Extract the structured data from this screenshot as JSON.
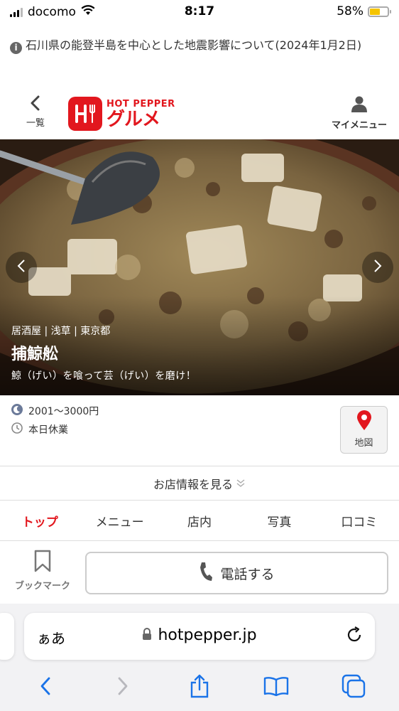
{
  "status_bar": {
    "carrier": "docomo",
    "time": "8:17",
    "battery_text": "58%",
    "battery_level": 0.58
  },
  "notice": {
    "text": "石川県の能登半島を中心とした地震影響について(2024年1月2日)"
  },
  "header": {
    "back_label": "一覧",
    "logo_top": "HOT PEPPER",
    "logo_bottom": "グルメ",
    "mymenu_label": "マイメニュー"
  },
  "hero": {
    "category": "居酒屋 | 浅草 | 東京都",
    "shop_name": "捕鯨舩",
    "catch_copy": "鯨（げい）を喰って芸（げい）を磨け！"
  },
  "info": {
    "budget": "2001〜3000円",
    "holiday": "本日休業",
    "map_label": "地図"
  },
  "shop_info_link": "お店情報を見る",
  "tabs": [
    {
      "label": "トップ",
      "active": true
    },
    {
      "label": "メニュー",
      "active": false
    },
    {
      "label": "店内",
      "active": false
    },
    {
      "label": "写真",
      "active": false
    },
    {
      "label": "口コミ",
      "active": false
    }
  ],
  "actions": {
    "bookmark_label": "ブックマーク",
    "call_label": "電話する"
  },
  "safari": {
    "aa_label": "ぁあ",
    "url": "hotpepper.jp"
  },
  "colors": {
    "brand_red": "#e2171e",
    "battery_yellow": "#f5c400"
  },
  "icons": [
    "wifi-icon",
    "battery-icon",
    "info-icon",
    "chevron-left-icon",
    "user-icon",
    "moon-icon",
    "clock-icon",
    "map-pin-icon",
    "chevron-down-icon",
    "bookmark-icon",
    "phone-icon",
    "lock-icon",
    "reload-icon",
    "share-icon",
    "book-icon",
    "tabs-icon"
  ]
}
